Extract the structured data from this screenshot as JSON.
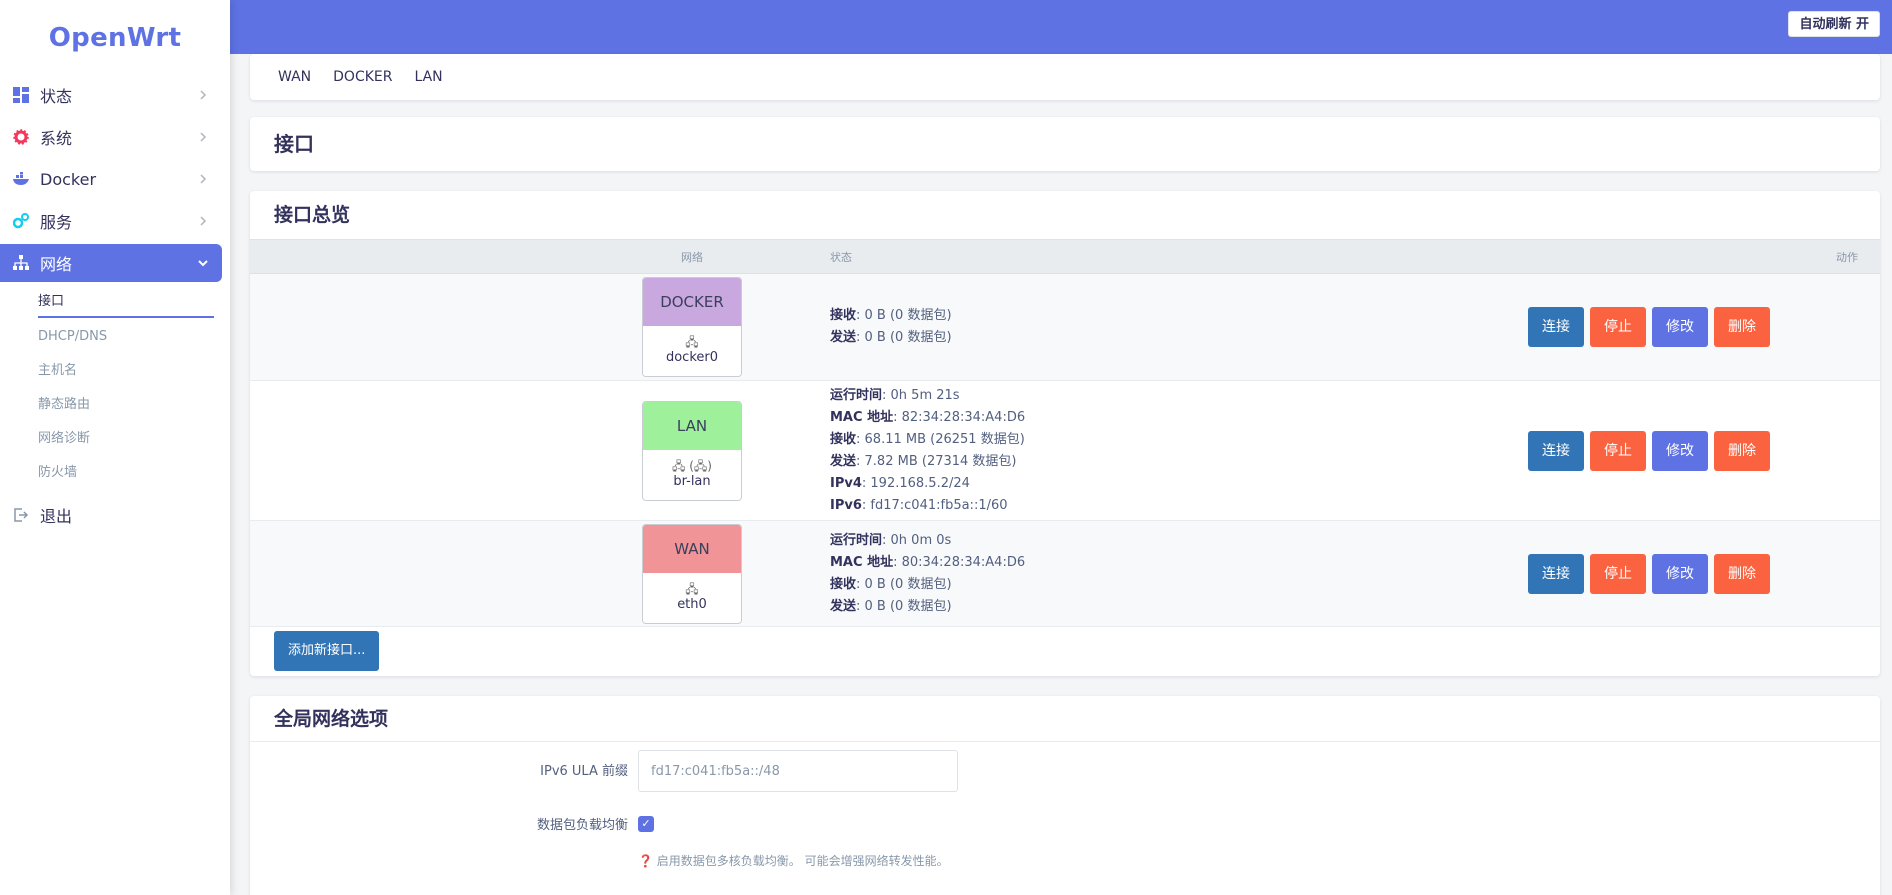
{
  "brand": "OpenWrt",
  "header": {
    "refresh_label": "自动刷新 开"
  },
  "sidebar": {
    "items": [
      {
        "label": "状态"
      },
      {
        "label": "系统"
      },
      {
        "label": "Docker"
      },
      {
        "label": "服务"
      },
      {
        "label": "网络"
      }
    ],
    "sub": [
      "接口",
      "DHCP/DNS",
      "主机名",
      "静态路由",
      "网络诊断",
      "防火墙"
    ],
    "logout": "退出"
  },
  "tabs": [
    "WAN",
    "DOCKER",
    "LAN"
  ],
  "page_title": "接口",
  "overview": {
    "title": "接口总览",
    "headers": {
      "network": "网络",
      "status": "状态",
      "actions": "动作"
    },
    "actions": {
      "connect": "连接",
      "stop": "停止",
      "edit": "修改",
      "delete": "删除"
    },
    "ifaces": [
      {
        "name": "DOCKER",
        "device": "docker0",
        "color": "#c9a8e0",
        "icon": "🖧",
        "lines": [
          {
            "k": "接收",
            "v": ": 0 B (0 数据包)"
          },
          {
            "k": "发送",
            "v": ": 0 B (0 数据包)"
          }
        ]
      },
      {
        "name": "LAN",
        "device": "br-lan",
        "color": "#9ef09a",
        "icon": "🖧 (🖧)",
        "lines": [
          {
            "k": "运行时间",
            "v": ": 0h 5m 21s"
          },
          {
            "k": "MAC 地址",
            "v": ": 82:34:28:34:A4:D6"
          },
          {
            "k": "接收",
            "v": ": 68.11 MB (26251 数据包)"
          },
          {
            "k": "发送",
            "v": ": 7.82 MB (27314 数据包)"
          },
          {
            "k": "IPv4",
            "v": ": 192.168.5.2/24"
          },
          {
            "k": "IPv6",
            "v": ": fd17:c041:fb5a::1/60"
          }
        ]
      },
      {
        "name": "WAN",
        "device": "eth0",
        "color": "#f09498",
        "icon": "🖧",
        "lines": [
          {
            "k": "运行时间",
            "v": ": 0h 0m 0s"
          },
          {
            "k": "MAC 地址",
            "v": ": 80:34:28:34:A4:D6"
          },
          {
            "k": "接收",
            "v": ": 0 B (0 数据包)"
          },
          {
            "k": "发送",
            "v": ": 0 B (0 数据包)"
          }
        ]
      }
    ],
    "add_label": "添加新接口..."
  },
  "global": {
    "title": "全局网络选项",
    "ula_label": "IPv6 ULA 前缀",
    "ula_value": "fd17:c041:fb5a::/48",
    "balance_label": "数据包负载均衡",
    "balance_help": "启用数据包多核负载均衡。 可能会增强网络转发性能。"
  }
}
